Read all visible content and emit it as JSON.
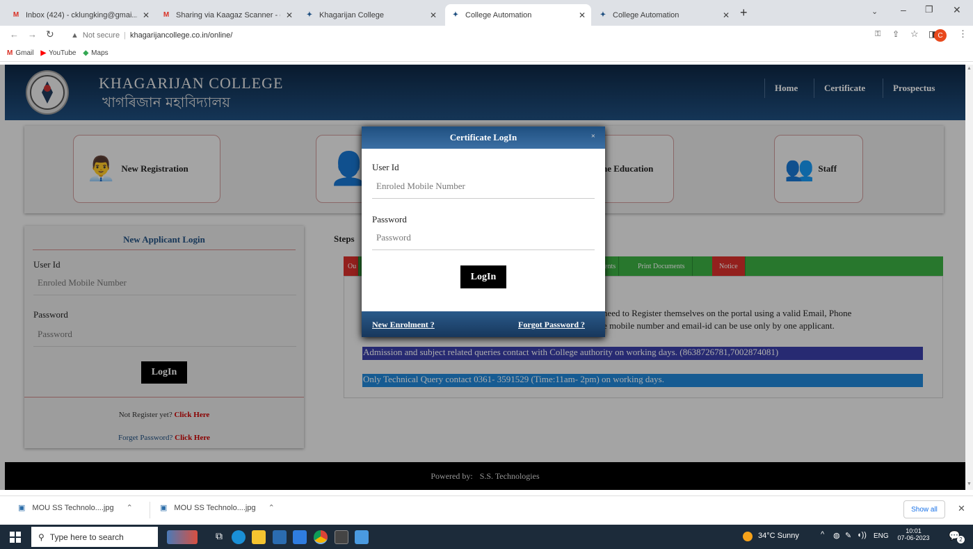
{
  "browser": {
    "tabs": [
      {
        "label": "Inbox (424) - cklungking@gmai...",
        "icon": "gmail-icon"
      },
      {
        "label": "Sharing via Kaagaz Scanner - ck...",
        "icon": "gmail-icon"
      },
      {
        "label": "Khagarijan College",
        "icon": "college-icon"
      },
      {
        "label": "College Automation",
        "icon": "college-icon",
        "active": true
      },
      {
        "label": "College Automation",
        "icon": "college-icon"
      }
    ],
    "new_tab": "+",
    "security": "Not secure",
    "url": "khagarijancollege.co.in/online/",
    "profile_initial": "C",
    "bookmarks": [
      {
        "label": "Gmail",
        "icon": "gmail-icon"
      },
      {
        "label": "YouTube",
        "icon": "youtube-icon"
      },
      {
        "label": "Maps",
        "icon": "maps-icon"
      }
    ]
  },
  "site": {
    "name_en": "KHAGARIJAN COLLEGE",
    "name_bn": "খাগৰিজান মহাবিদ্যালয়",
    "nav": [
      "Home",
      "Certificate",
      "Prospectus"
    ],
    "tiles": [
      "New Registration",
      "",
      "ne Education",
      "Staff"
    ],
    "left_login": {
      "title": "New Applicant Login",
      "user_label": "User Id",
      "user_placeholder": "Enroled Mobile Number",
      "pass_label": "Password",
      "pass_placeholder": "Password",
      "button": "LogIn",
      "not_register_text": "Not Register yet?",
      "not_register_link": "Click Here",
      "forget_text": "Forget Password?",
      "forget_link": "Click Here"
    },
    "steps_label": "Steps",
    "page_tabs": [
      "Ou",
      "ents",
      "Print Documents",
      "Notice"
    ],
    "info_line1": "need to Register themselves on the portal using a valid Email, Phone",
    "info_line2": "e mobile number and email-id can be use only by one applicant.",
    "notice_admission": "Admission and subject related queries contact with College authority on working days. (8638726781,7002874081)",
    "notice_technical": "Only Technical Query contact 0361- 3591529 (Time:11am- 2pm) on working days.",
    "footer_label": "Powered by:",
    "footer_company": "S.S. Technologies",
    "colors": {
      "header": "#1f4f80",
      "tabs_green": "#3cb043",
      "tab_red": "#d9302c",
      "notice1": "#3a3fa8",
      "notice2": "#2187d8"
    }
  },
  "modal": {
    "title": "Certificate LogIn",
    "close": "×",
    "user_label": "User Id",
    "user_placeholder": "Enroled Mobile Number",
    "pass_label": "Password",
    "pass_placeholder": "Password",
    "button": "LogIn",
    "new_enrolment": "New Enrolment ?",
    "forgot": "Forgot Password ?"
  },
  "downloads": {
    "items": [
      "MOU SS Technolo....jpg",
      "MOU SS Technolo....jpg"
    ],
    "show_all": "Show all"
  },
  "taskbar": {
    "search_placeholder": "Type here to search",
    "weather": "34°C  Sunny",
    "lang": "ENG",
    "time": "10:01",
    "date": "07-06-2023",
    "notif_count": "2"
  }
}
